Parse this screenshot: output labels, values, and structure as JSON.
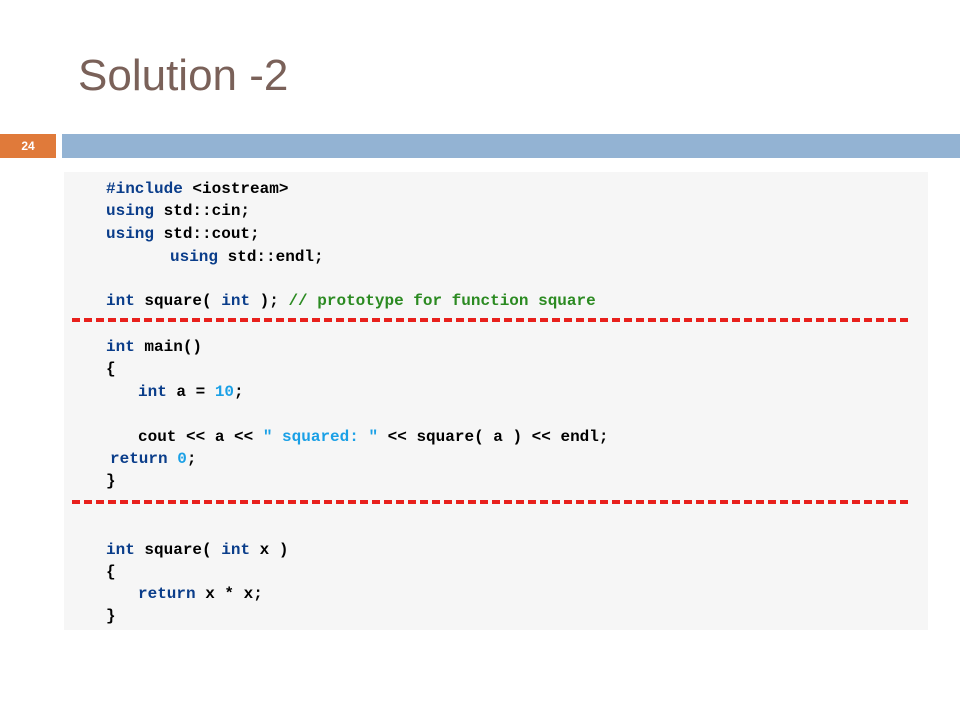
{
  "slide": {
    "title": "Solution -2",
    "number": "24"
  },
  "colors": {
    "title": "#7a6159",
    "badge": "#e07a3a",
    "header_bar": "#93b3d3",
    "panel": "#f6f6f6",
    "keyword": "#0a3d8a",
    "number": "#1aa0e6",
    "comment": "#2b8a21",
    "divider": "#e8201c"
  },
  "code": {
    "include_kw": "#include",
    "include_rest": " <iostream>",
    "using1_kw": "using",
    "using1_rest": " std::cin;",
    "using2_kw": "using",
    "using2_rest": " std::cout;",
    "using3_kw": "using",
    "using3_rest": " std::endl;",
    "proto_kw1": "int",
    "proto_mid": " square( ",
    "proto_kw2": "int",
    "proto_end": " ); ",
    "proto_comment": "// prototype for function square",
    "main_kw": "int",
    "main_rest": " main()",
    "main_open": "{",
    "decl_kw": "int",
    "decl_mid": " a = ",
    "decl_num": "10",
    "decl_end": ";",
    "cout_start": "cout << a << ",
    "cout_str": "\" squared: \"",
    "cout_end": " << square( a ) << endl;",
    "return_kw": "return",
    "return_num": " 0",
    "return_end": ";",
    "main_close": "}",
    "def_kw1": "int",
    "def_mid": " square( ",
    "def_kw2": "int",
    "def_end": " x )",
    "def_open": "{",
    "def_return_kw": "return",
    "def_return_rest": " x * x;",
    "def_close": "}"
  }
}
